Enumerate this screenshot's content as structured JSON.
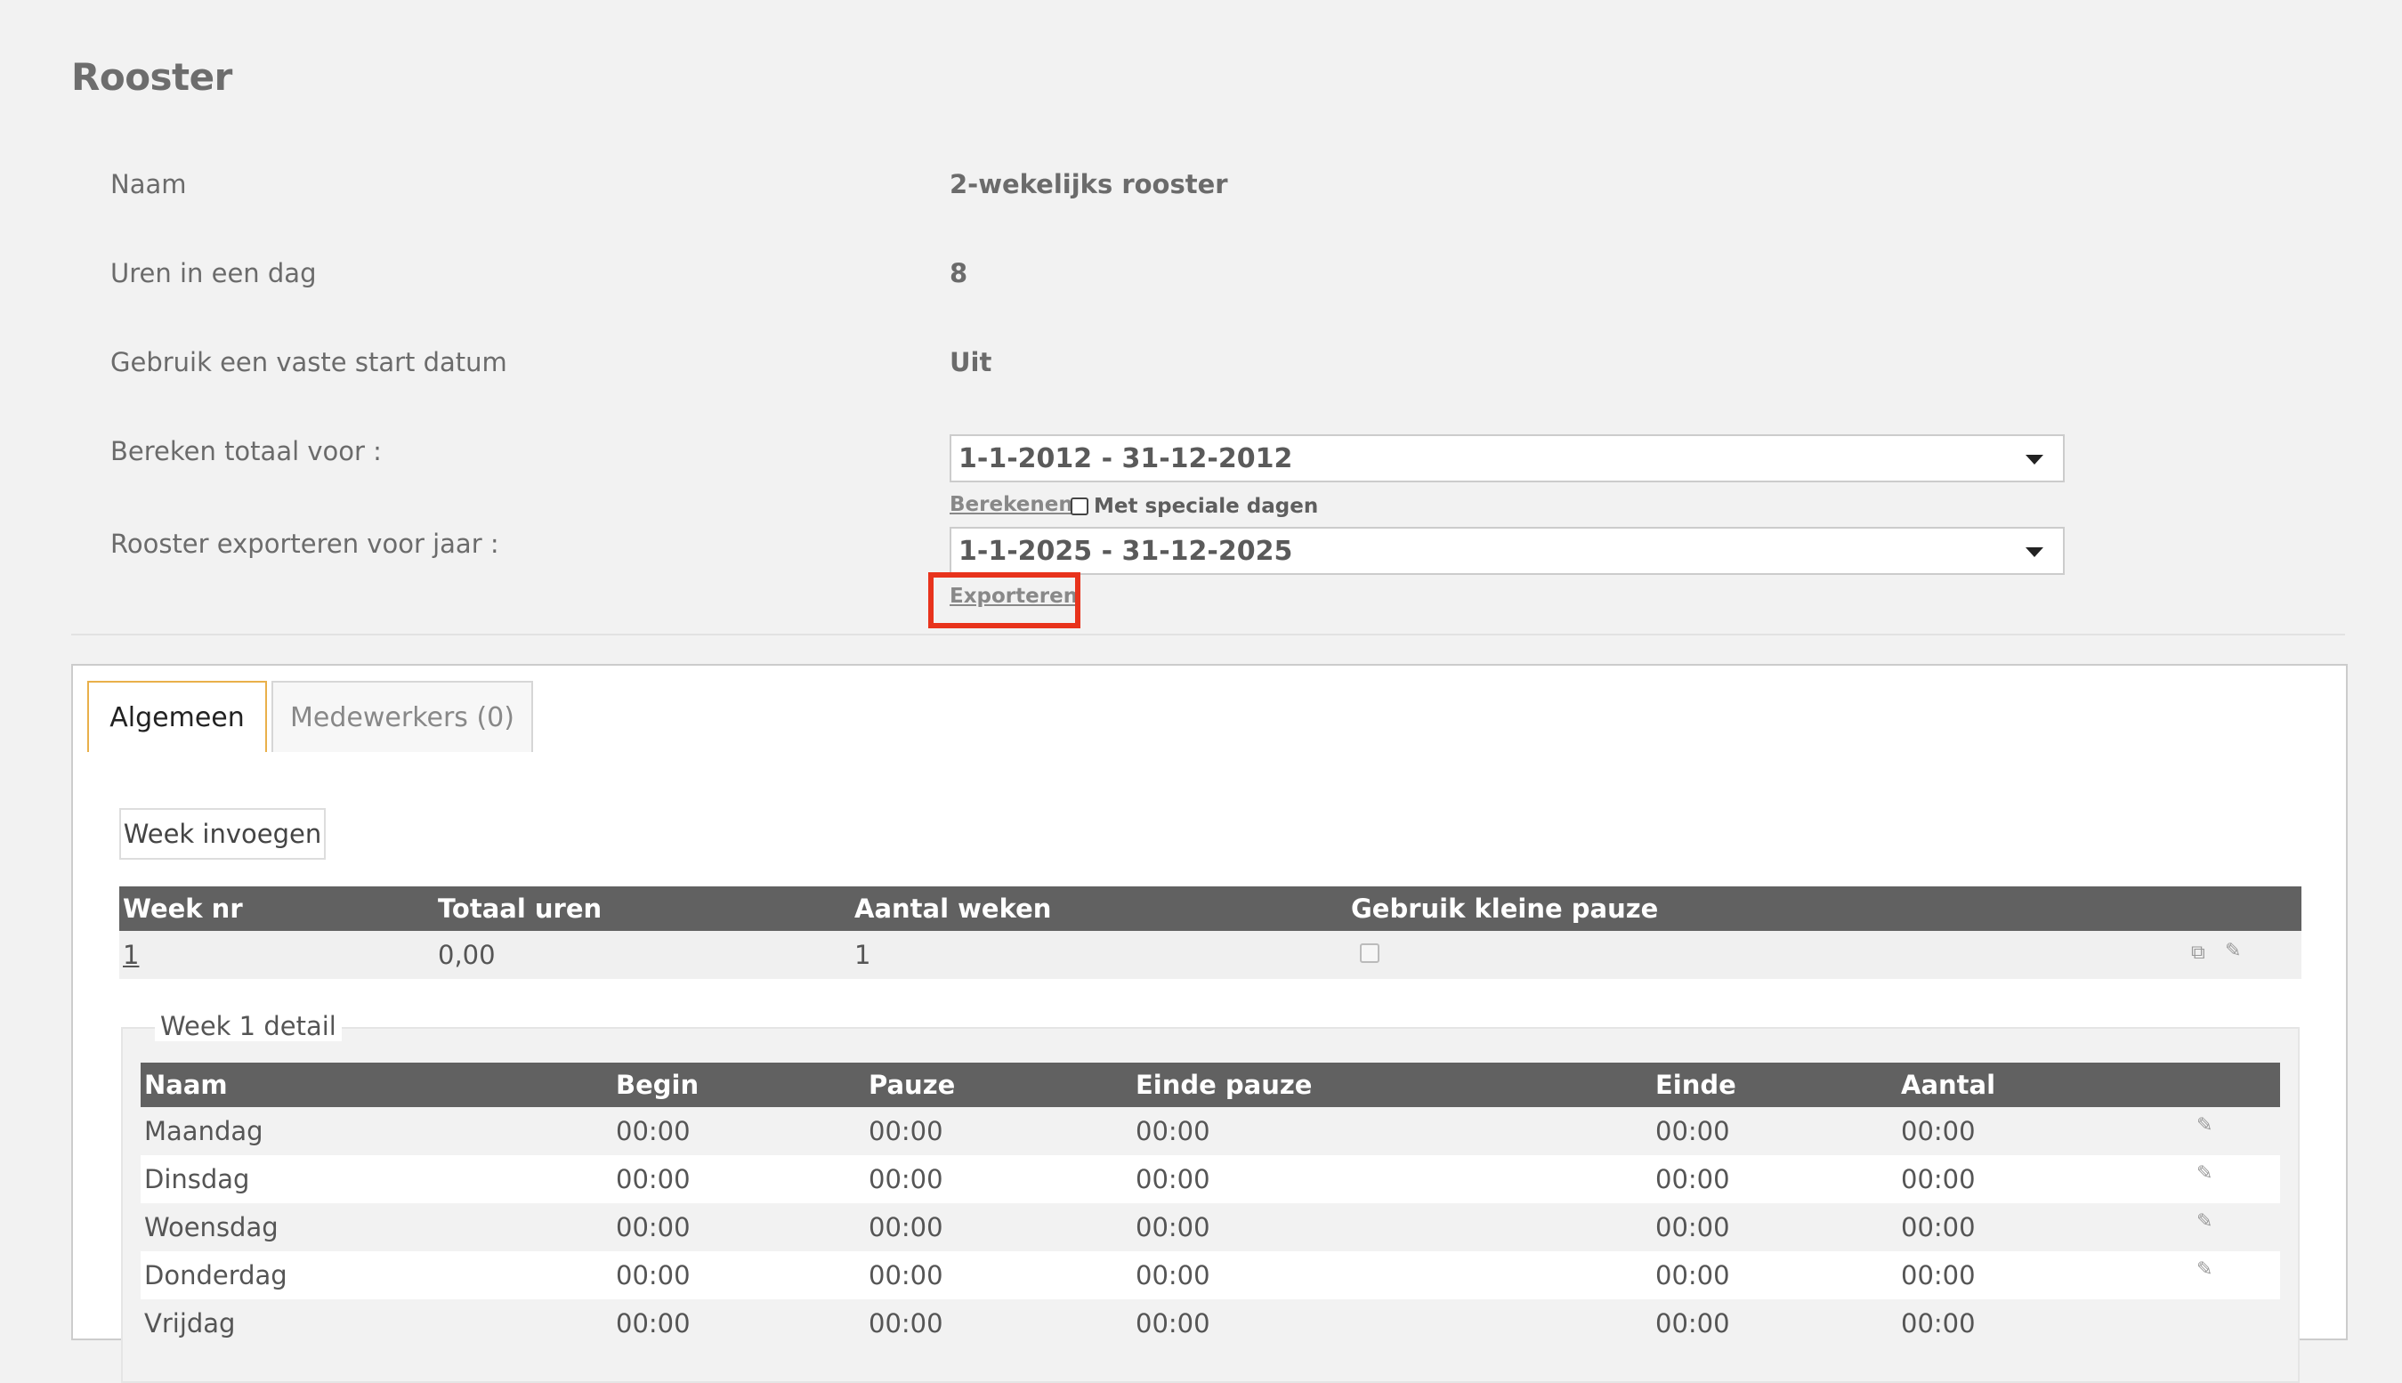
{
  "page": {
    "title": "Rooster"
  },
  "fields": {
    "naam": {
      "label": "Naam",
      "value": "2-wekelijks rooster"
    },
    "uren": {
      "label": "Uren in een dag",
      "value": "8"
    },
    "vaste_start": {
      "label": "Gebruik een vaste start datum",
      "value": "Uit"
    },
    "bereken": {
      "label": "Bereken totaal voor :",
      "selected": "1-1-2012 - 31-12-2012",
      "link": "Berekenen",
      "checkbox_label": "Met speciale dagen"
    },
    "exporteren": {
      "label": "Rooster exporteren voor jaar :",
      "selected": "1-1-2025 - 31-12-2025",
      "link": "Exporteren"
    }
  },
  "tabs": [
    {
      "label": "Algemeen",
      "active": true
    },
    {
      "label": "Medewerkers (0)",
      "active": false
    }
  ],
  "week_button": "Week invoegen",
  "week_table": {
    "headers": [
      "Week nr",
      "Totaal uren",
      "Aantal weken",
      "Gebruik kleine pauze"
    ],
    "rows": [
      {
        "week_nr": "1",
        "totaal": "0,00",
        "aantal": "1"
      }
    ]
  },
  "detail": {
    "legend": "Week 1 detail",
    "headers": [
      "Naam",
      "Begin",
      "Pauze",
      "Einde pauze",
      "Einde",
      "Aantal"
    ],
    "rows": [
      {
        "naam": "Maandag",
        "begin": "00:00",
        "pauze": "00:00",
        "einde_pauze": "00:00",
        "einde": "00:00",
        "aantal": "00:00"
      },
      {
        "naam": "Dinsdag",
        "begin": "00:00",
        "pauze": "00:00",
        "einde_pauze": "00:00",
        "einde": "00:00",
        "aantal": "00:00"
      },
      {
        "naam": "Woensdag",
        "begin": "00:00",
        "pauze": "00:00",
        "einde_pauze": "00:00",
        "einde": "00:00",
        "aantal": "00:00"
      },
      {
        "naam": "Donderdag",
        "begin": "00:00",
        "pauze": "00:00",
        "einde_pauze": "00:00",
        "einde": "00:00",
        "aantal": "00:00"
      },
      {
        "naam": "Vrijdag",
        "begin": "00:00",
        "pauze": "00:00",
        "einde_pauze": "00:00",
        "einde": "00:00",
        "aantal": "00:00"
      }
    ]
  },
  "colors": {
    "highlight": "#e8331c",
    "tab_accent": "#e9b04a",
    "table_header": "#616161"
  }
}
